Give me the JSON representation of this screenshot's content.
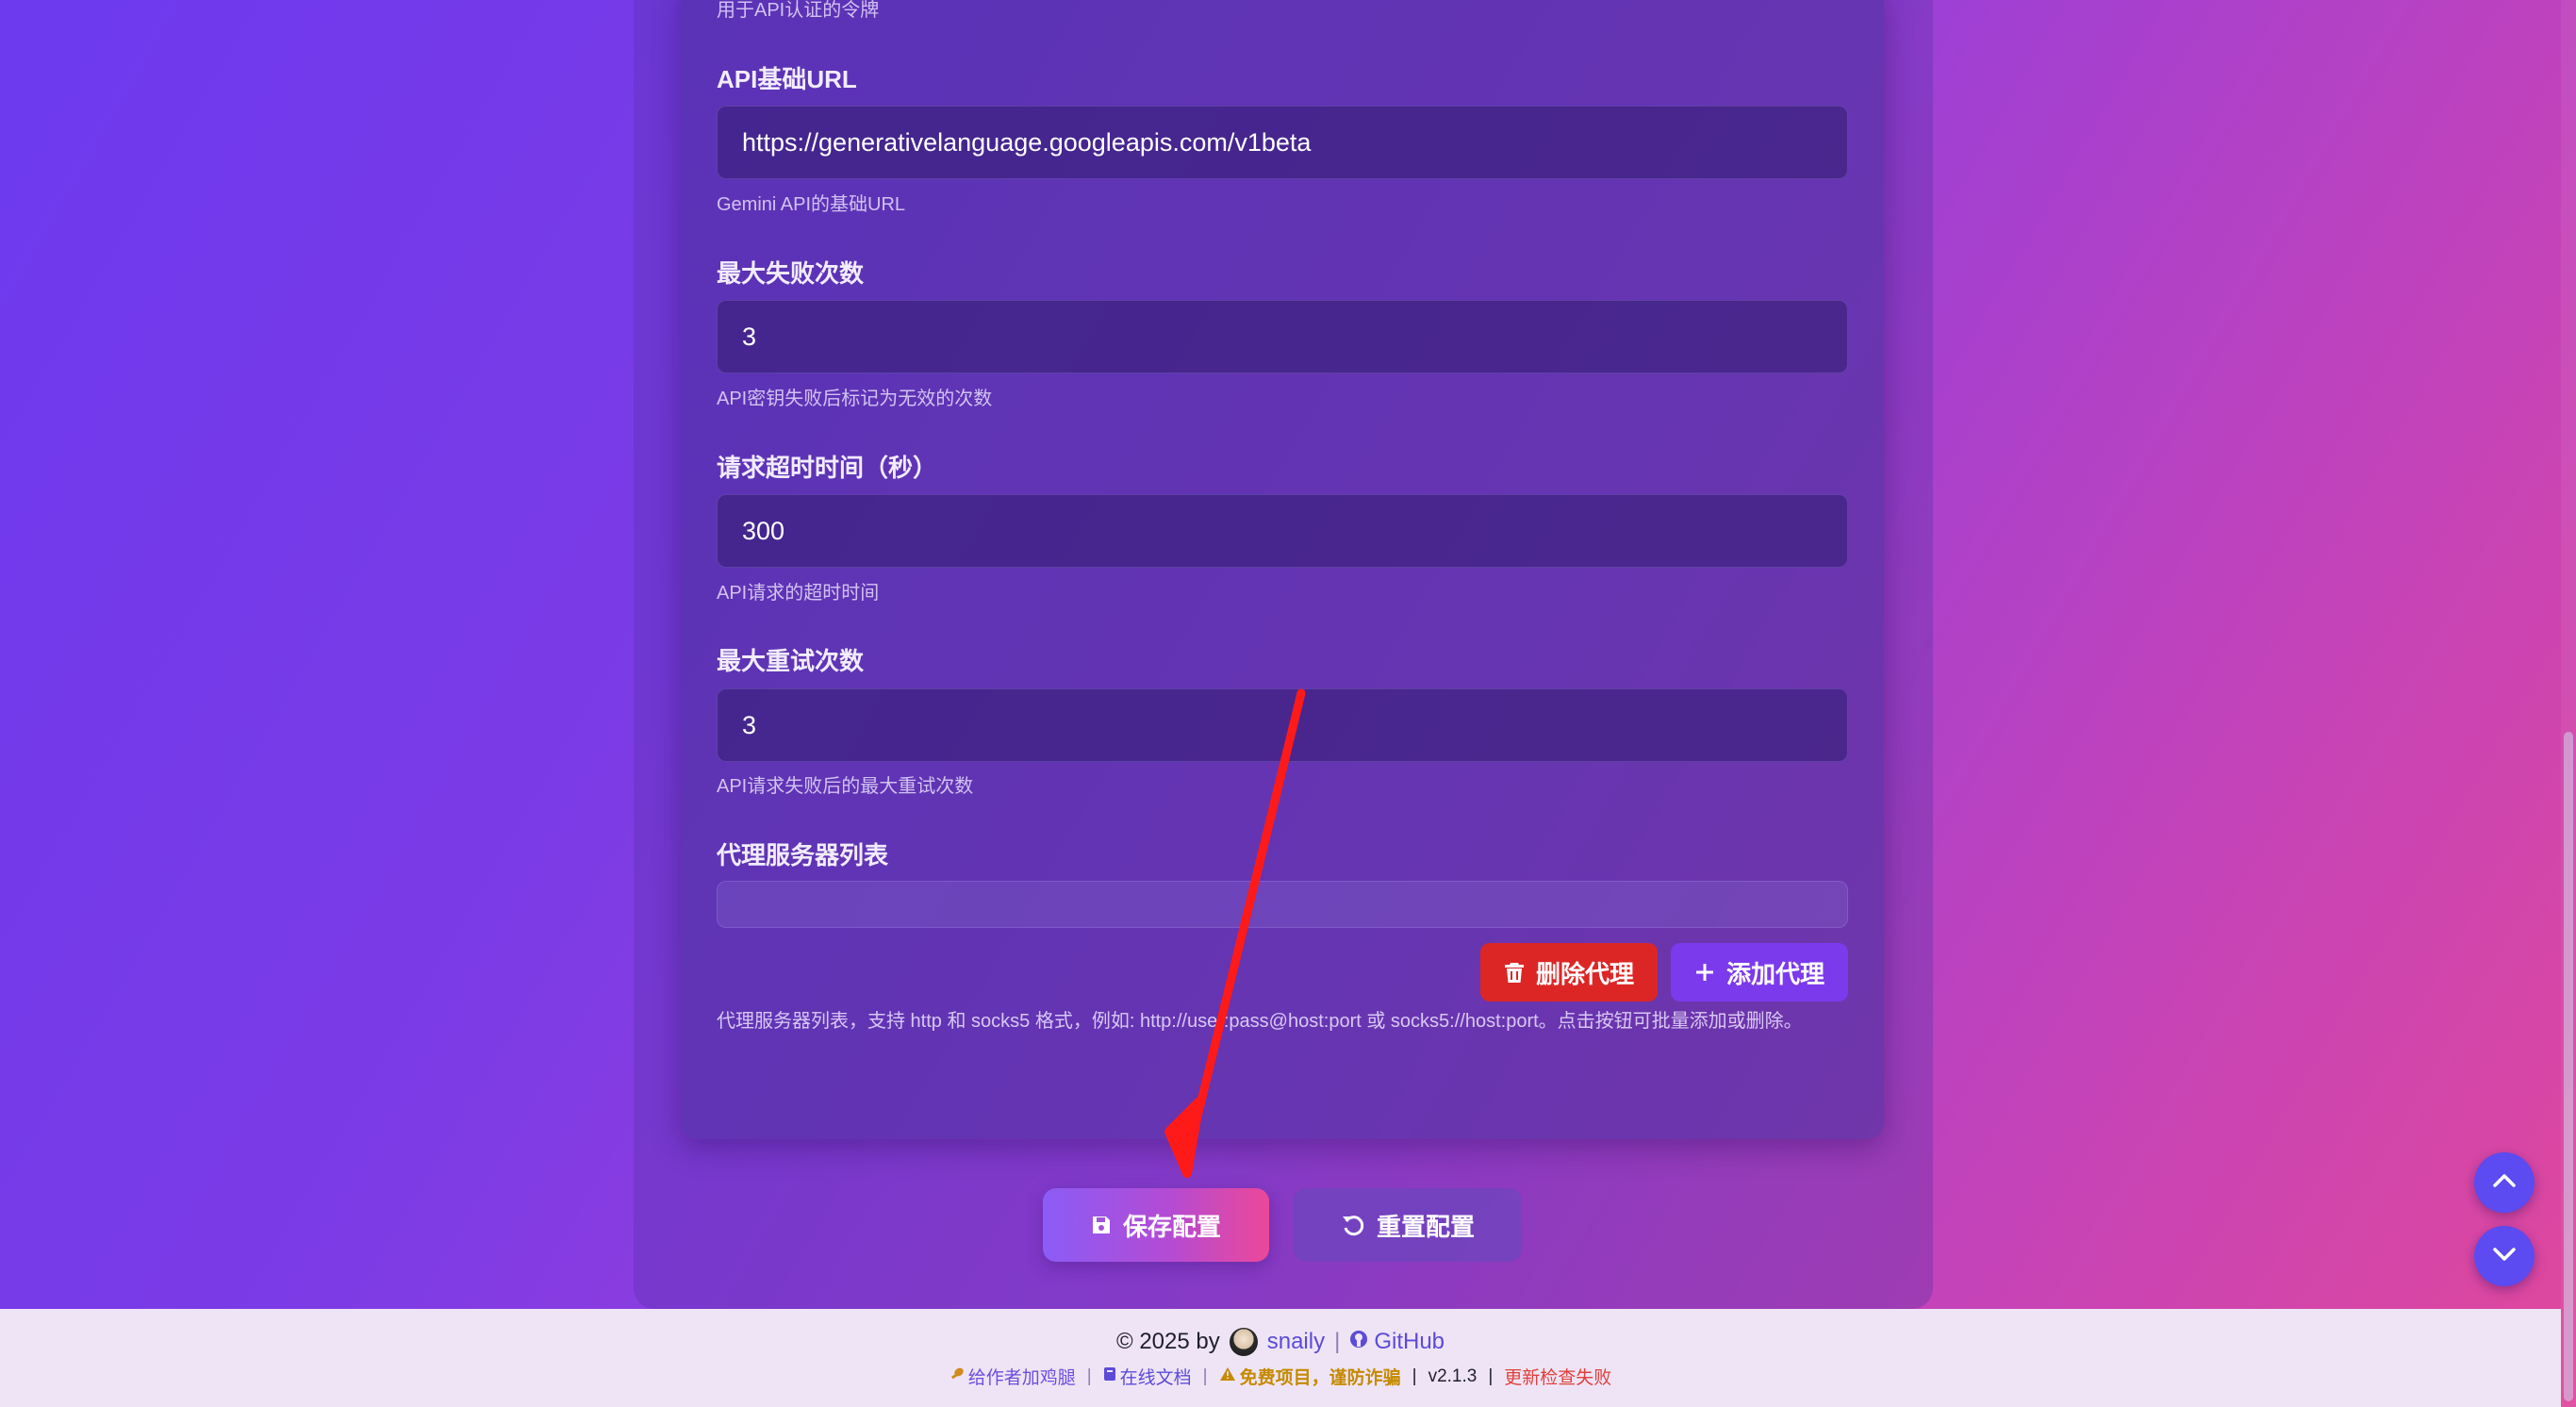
{
  "form": {
    "token_hint": "用于API认证的令牌",
    "api_base_url": {
      "label": "API基础URL",
      "value": "https://generativelanguage.googleapis.com/v1beta",
      "hint": "Gemini API的基础URL"
    },
    "max_failures": {
      "label": "最大失败次数",
      "value": "3",
      "hint": "API密钥失败后标记为无效的次数"
    },
    "timeout": {
      "label": "请求超时时间（秒）",
      "value": "300",
      "hint": "API请求的超时时间"
    },
    "max_retries": {
      "label": "最大重试次数",
      "value": "3",
      "hint": "API请求失败后的最大重试次数"
    },
    "proxy": {
      "label": "代理服务器列表",
      "delete_label": "删除代理",
      "add_label": "添加代理",
      "description": "代理服务器列表，支持 http 和 socks5 格式，例如: http://user:pass@host:port 或 socks5://host:port。点击按钮可批量添加或删除。"
    }
  },
  "actions": {
    "save_label": "保存配置",
    "reset_label": "重置配置"
  },
  "footer": {
    "copyright": "© 2025 by",
    "author": "snaily",
    "github": "GitHub",
    "donate": "给作者加鸡腿",
    "docs": "在线文档",
    "warning": "免费项目，谨防诈骗",
    "version": "v2.1.3",
    "update_status": "更新检查失败"
  },
  "colors": {
    "delete": "#dc2626",
    "add": "#7c3aed",
    "annotation_arrow": "#ff1a1a"
  }
}
